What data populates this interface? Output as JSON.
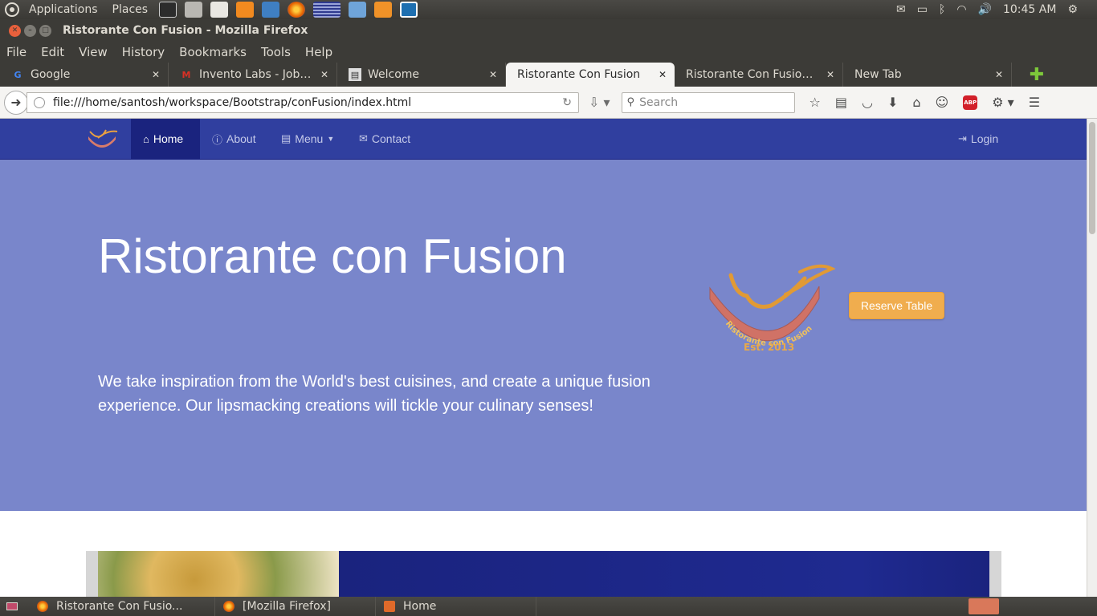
{
  "top_panel": {
    "applications": "Applications",
    "places": "Places",
    "clock": "10:45 AM"
  },
  "window": {
    "title": "Ristorante Con Fusion - Mozilla Firefox"
  },
  "menubar": {
    "items": [
      "File",
      "Edit",
      "View",
      "History",
      "Bookmarks",
      "Tools",
      "Help"
    ]
  },
  "tabs": [
    {
      "title": "Google",
      "icon": "google-icon"
    },
    {
      "title": "Invento Labs - Job O...",
      "icon": "gmail-icon"
    },
    {
      "title": "Welcome",
      "icon": "page-icon"
    },
    {
      "title": "Ristorante Con Fusion",
      "icon": "none",
      "active": true
    },
    {
      "title": "Ristorante Con Fusion: ...",
      "icon": "none"
    },
    {
      "title": "New Tab",
      "icon": "none"
    }
  ],
  "toolbar": {
    "url": "file:///home/santosh/workspace/Bootstrap/conFusion/index.html",
    "search_placeholder": "Search"
  },
  "site": {
    "nav": {
      "home": "Home",
      "about": "About",
      "menu": "Menu",
      "contact": "Contact",
      "login": "Login"
    },
    "jumbotron": {
      "title": "Ristorante con Fusion",
      "text": "We take inspiration from the World's best cuisines, and create a unique fusion experience. Our lipsmacking creations will tickle your culinary senses!",
      "reserve": "Reserve Table"
    },
    "logo": {
      "ring_text": "Ristorante con Fusion",
      "est": "Est. 2013"
    }
  },
  "taskbar": {
    "items": [
      "Ristorante Con Fusio...",
      "[Mozilla Firefox]",
      "Home"
    ]
  },
  "colors": {
    "primary": "#303f9f",
    "primary_dark": "#1a237e",
    "jumbotron": "#7986cb",
    "warning": "#f0ad4e"
  }
}
